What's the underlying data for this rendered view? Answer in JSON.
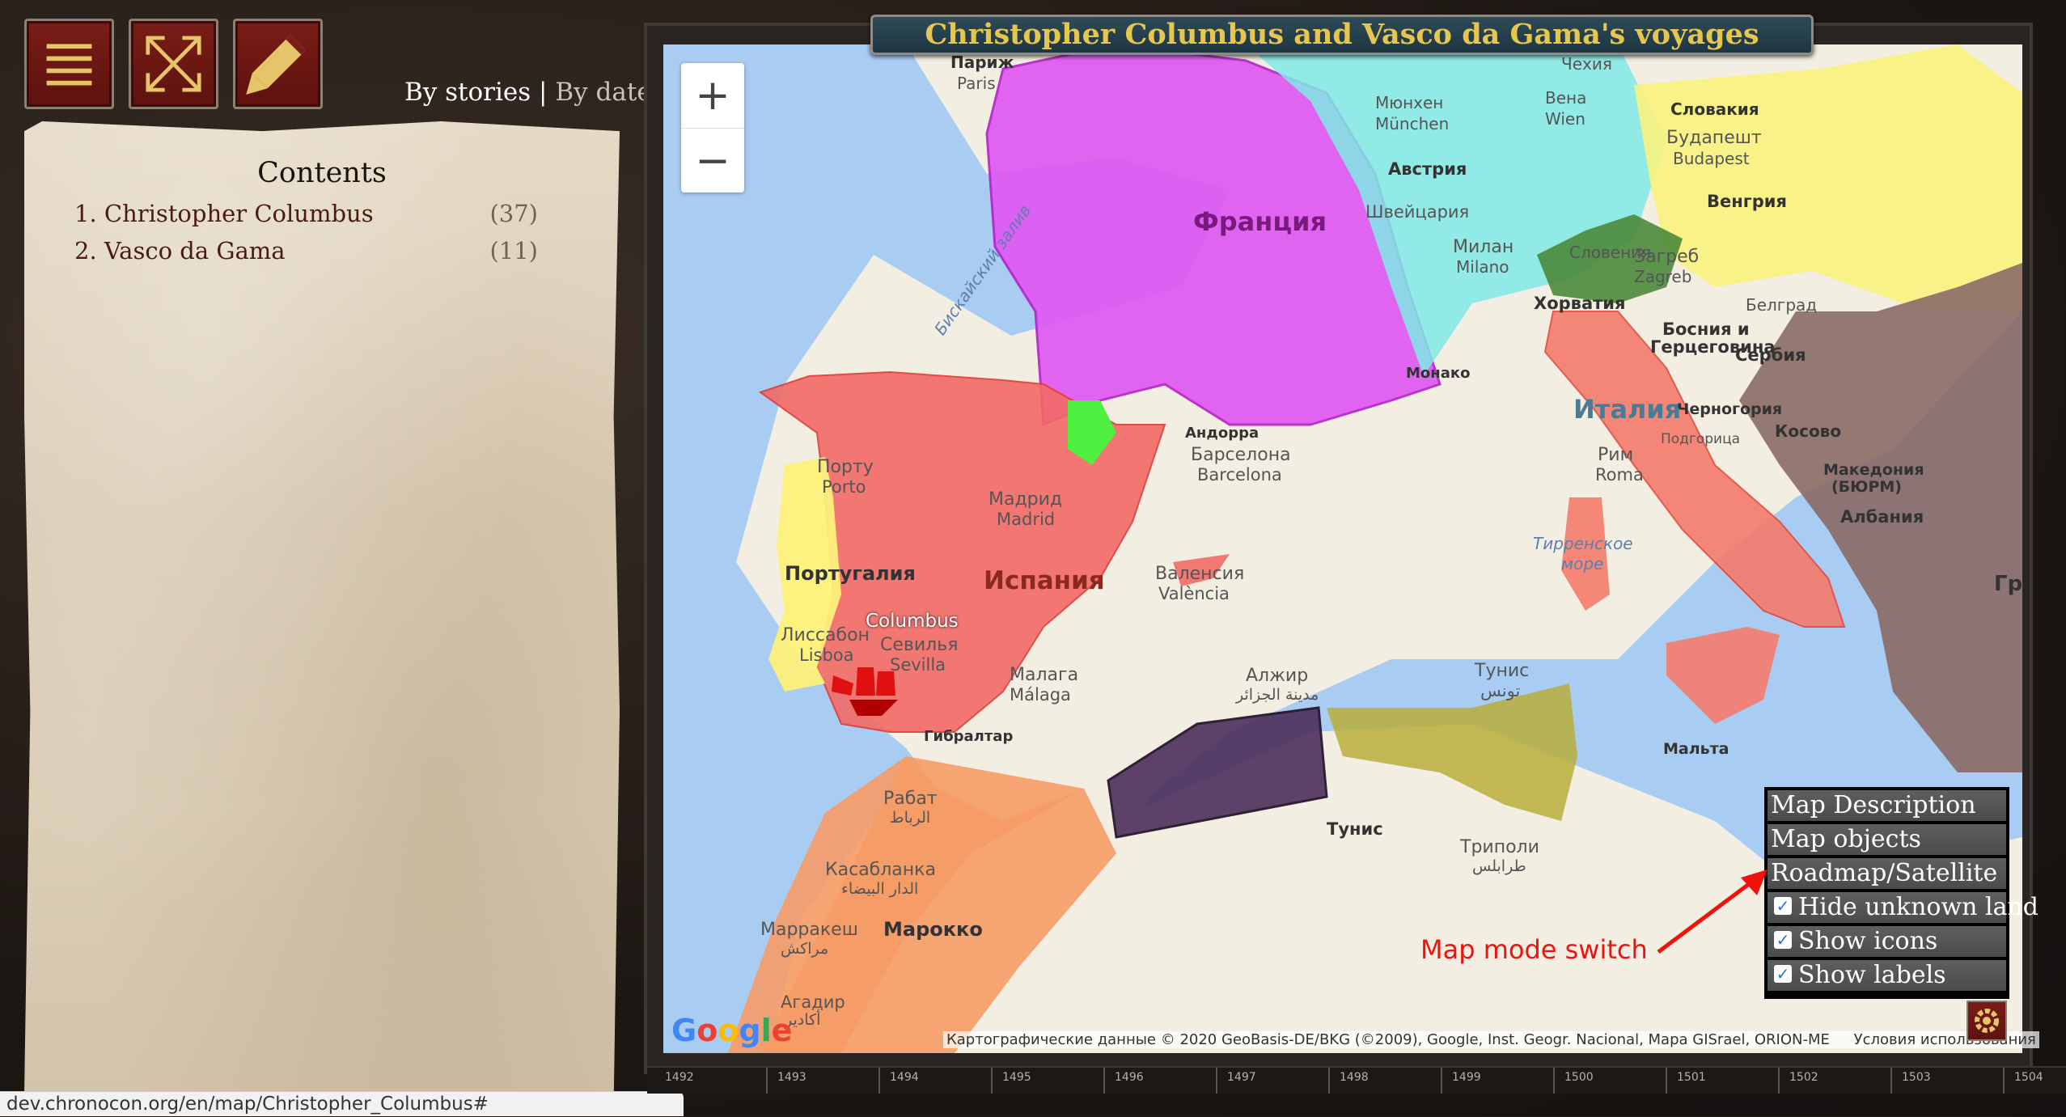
{
  "toolbar": {
    "menu_icon": "hamburger-icon",
    "fullscreen_icon": "expand-icon",
    "edit_icon": "pencil-icon"
  },
  "view_switch": {
    "active": "By stories",
    "separator": "|",
    "alternate": "By dates"
  },
  "contents": {
    "title": "Contents",
    "items": [
      {
        "label": "1. Christopher Columbus",
        "count": "(37)"
      },
      {
        "label": "2. Vasco da Gama",
        "count": "(11)"
      }
    ]
  },
  "status_url": "dev.chronocon.org/en/map/Christopher_Columbus#",
  "map": {
    "title": "Christopher Columbus and Vasco da Gama's voyages",
    "zoom_in": "+",
    "zoom_out": "−",
    "labels": {
      "paris_ru": "Париж",
      "paris": "Paris",
      "czech": "Чехия",
      "munich_ru": "Мюнхен",
      "munich": "München",
      "vienna_ru": "Вена",
      "vienna": "Wien",
      "slovakia": "Словакия",
      "budapest_ru": "Будапешт",
      "budapest": "Budapest",
      "austria": "Австрия",
      "hungary": "Венгрия",
      "france": "Франция",
      "switzerland": "Швейцария",
      "milan_ru": "Милан",
      "milan": "Milano",
      "slovenia": "Словения",
      "zagreb_ru": "Загреб",
      "zagreb": "Zagreb",
      "croatia": "Хорватия",
      "belgrade": "Белград",
      "biscay": "Бискайский залив",
      "bosnia1": "Босния и",
      "bosnia2": "Герцеговина",
      "serbia": "Сербия",
      "monaco": "Монако",
      "italy": "Италия",
      "andorra": "Андорра",
      "montenegro": "Черногория",
      "kosovo": "Косово",
      "podgorica": "Подгорица",
      "porto_ru": "Порту",
      "porto": "Porto",
      "barcelona_ru": "Барселона",
      "barcelona": "Barcelona",
      "rome_ru": "Рим",
      "rome": "Roma",
      "macedonia1": "Македония",
      "macedonia2": "(БЮРМ)",
      "madrid_ru": "Мадрид",
      "madrid": "Madrid",
      "albania": "Албания",
      "tyrrhenian1": "Тирренское",
      "tyrrhenian2": "море",
      "portugal": "Португалия",
      "spain": "Испания",
      "valencia_ru": "Валенсия",
      "valencia": "València",
      "greece": "Греци",
      "columbus": "Columbus",
      "lisbon_ru": "Лиссабон",
      "lisbon": "Lisboa",
      "seville_ru": "Севилья",
      "seville": "Sevilla",
      "tunis_city_ru": "Тунис",
      "tunis_city_ar": "تونس",
      "algiers_ru": "Алжир",
      "algiers_ar": "مدينة الجزائر",
      "malaga_ru": "Малага",
      "malaga": "Málaga",
      "gibraltar": "Гибралтар",
      "malta": "Мальта",
      "rabat_ru": "Рабат",
      "rabat_ar": "الرباط",
      "tunisia": "Тунис",
      "tripoli_ru": "Триполи",
      "tripoli_ar": "طرابلس",
      "casablanca_ru": "Касабланка",
      "casablanca_ar": "الدار البيضاء",
      "marrakesh_ru": "Марракеш",
      "marrakesh_ar": "مراكش",
      "morocco": "Марокко",
      "agadir_ru": "Агадир",
      "agadir_ar": "أكادير"
    },
    "attribution": "Картографические данные © 2020 GeoBasis-DE/BKG (©2009), Google, Inst. Geogr. Nacional, Mapa GISrael, ORION-ME",
    "terms": "Условия использования",
    "google_logo": "Google",
    "colors": {
      "spain": "#f26a66",
      "portugal": "#fdf07a",
      "france": "#e056f2",
      "italy": "#f57b6c",
      "hre": "#7fe9e6",
      "hungary": "#faf27e",
      "morocco": "#f69b66",
      "ottoman": "#8a6a66",
      "tlemcen": "#4e2f5c",
      "hafsid": "#b7ae3a",
      "navarre": "#4ef03f",
      "milan": "#4a8a3a",
      "sea": "#a9ccf2",
      "land": "#f3eee2"
    }
  },
  "map_menu": {
    "items": [
      "Map Description",
      "Map objects",
      "Roadmap/Satellite"
    ],
    "checks": [
      {
        "label": "Hide unknown land",
        "checked": true
      },
      {
        "label": "Show icons",
        "checked": true
      },
      {
        "label": "Show labels",
        "checked": true
      }
    ],
    "gear_icon": "gear-icon"
  },
  "annotation": "Map mode switch",
  "timeline": {
    "years": [
      "1492",
      "1493",
      "1494",
      "1495",
      "1496",
      "1497",
      "1498",
      "1499",
      "1500",
      "1501",
      "1502",
      "1503",
      "1504"
    ]
  }
}
